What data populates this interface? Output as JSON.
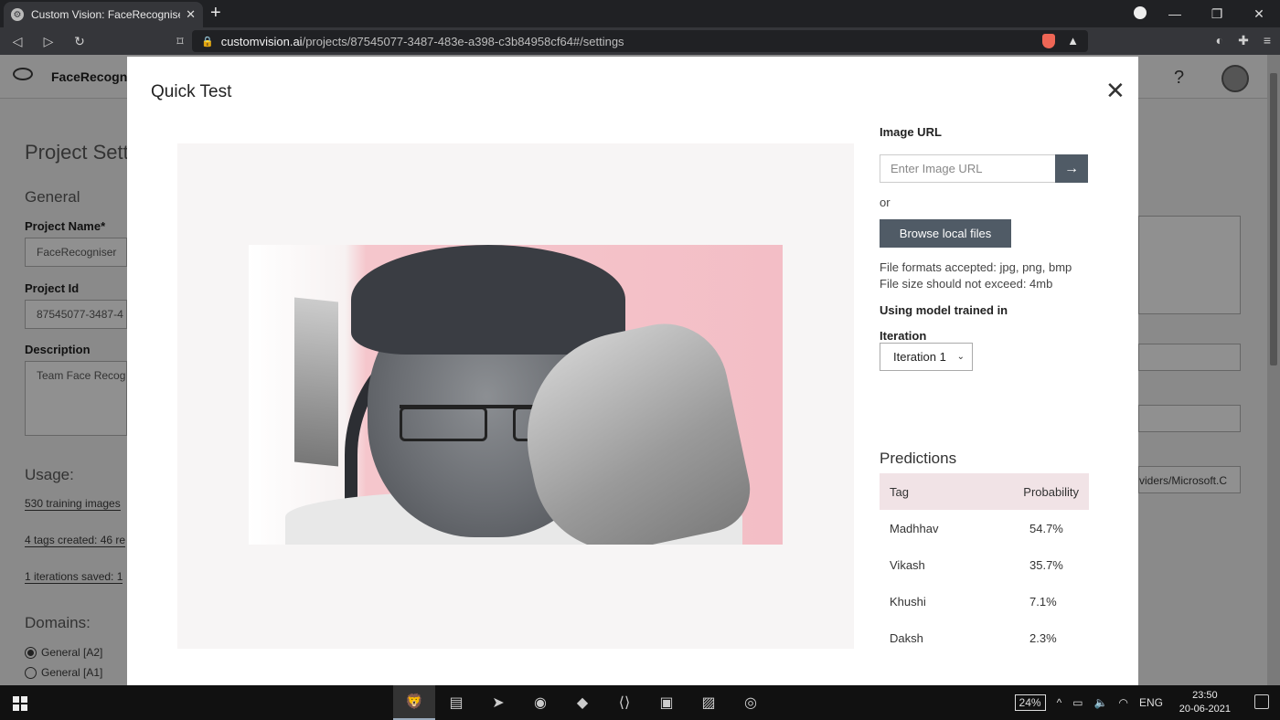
{
  "browser": {
    "tab_title": "Custom Vision: FaceRecogniser - C",
    "url_domain": "customvision.ai",
    "url_path": "/projects/87545077-3487-483e-a398-c3b84958cf64#/settings"
  },
  "background_page": {
    "app_name": "FaceRecogniser",
    "page_title": "Project Setti",
    "general_heading": "General",
    "project_name_label": "Project Name*",
    "project_name_value": "FaceRecogniser",
    "project_id_label": "Project Id",
    "project_id_value": "87545077-3487-4",
    "description_label": "Description",
    "description_value": "Team Face Recog",
    "usage_heading": "Usage:",
    "usage_images": "530 training images",
    "usage_tags": "4 tags created: 46 re",
    "usage_iterations": "1 iterations saved: 1",
    "domains_heading": "Domains:",
    "domain_a2": "General [A2]",
    "domain_a1": "General [A1]",
    "right_field_text": "viders/Microsoft.C"
  },
  "modal": {
    "title": "Quick Test",
    "image_url_label": "Image URL",
    "image_url_placeholder": "Enter Image URL",
    "or_text": "or",
    "browse_button": "Browse local files",
    "formats_text": "File formats accepted: jpg, png, bmp",
    "size_text": "File size should not exceed: 4mb",
    "model_label": "Using model trained in",
    "iteration_label": "Iteration",
    "iteration_selected": "Iteration 1",
    "predictions_title": "Predictions",
    "table_headers": {
      "tag": "Tag",
      "probability": "Probability"
    },
    "predictions": [
      {
        "tag": "Madhhav",
        "probability": "54.7%"
      },
      {
        "tag": "Vikash",
        "probability": "35.7%"
      },
      {
        "tag": "Khushi",
        "probability": "7.1%"
      },
      {
        "tag": "Daksh",
        "probability": "2.3%"
      }
    ]
  },
  "taskbar": {
    "battery": "24%",
    "language": "ENG",
    "time": "23:50",
    "date": "20-06-2021"
  },
  "colors": {
    "button_bg": "#505b66",
    "table_header_bg": "#f1e3e6"
  }
}
